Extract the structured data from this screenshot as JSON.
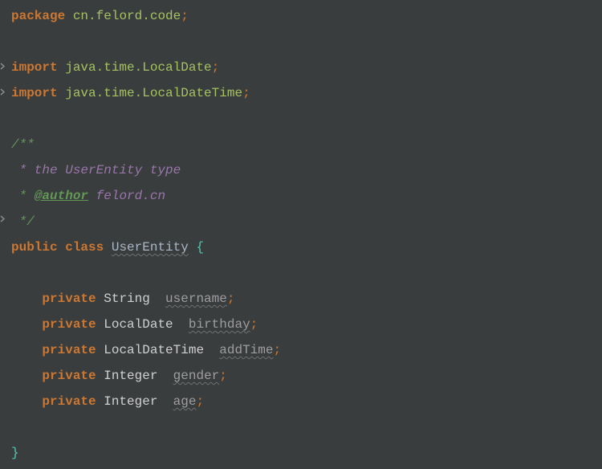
{
  "tokens": {
    "package_kw": "package",
    "package_name": "cn.felord.code",
    "import_kw": "import",
    "import1": "java.time.LocalDate",
    "import2": "java.time.LocalDateTime",
    "doc_open": "/**",
    "doc_line1": " * the UserEntity type",
    "doc_prefix": " * ",
    "doc_author_tag": "@author",
    "doc_author_val": " felord.cn",
    "doc_close": " */",
    "public_kw": "public",
    "class_kw": "class",
    "class_name": "UserEntity",
    "private_kw": "private",
    "type_string": "String",
    "type_localdate": "LocalDate",
    "type_localdatetime": "LocalDateTime",
    "type_integer": "Integer",
    "field_username": "username",
    "field_birthday": "birthday",
    "field_addtime": "addTime",
    "field_gender": "gender",
    "field_age": "age",
    "semi": ";",
    "open_brace": "{",
    "close_brace": "}"
  }
}
